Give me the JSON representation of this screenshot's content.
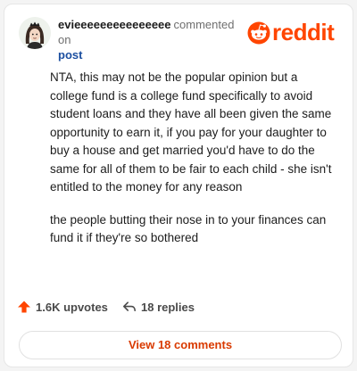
{
  "comment": {
    "username": "evieeeeeeeeeeeeeee",
    "action_text": "commented on",
    "target_link": "post",
    "brand_name": "reddit",
    "brand_color": "#ff4500",
    "paragraphs": [
      "NTA, this may not be the popular opinion but a college fund is a college fund specifically to avoid student loans and they have all been given the same opportunity to earn it, if you pay for your daughter to buy a house and get married you'd have to do the same for all of them to be fair to each child - she isn't entitled to the money for any reason",
      "the people butting their nose in to your finances can fund it if they're so bothered"
    ]
  },
  "actions": {
    "upvotes_label": "1.6K upvotes",
    "replies_label": "18 replies",
    "upvote_icon": "arrow-up-icon",
    "reply_icon": "reply-arrow-icon"
  },
  "footer": {
    "view_comments_label": "View 18 comments"
  }
}
